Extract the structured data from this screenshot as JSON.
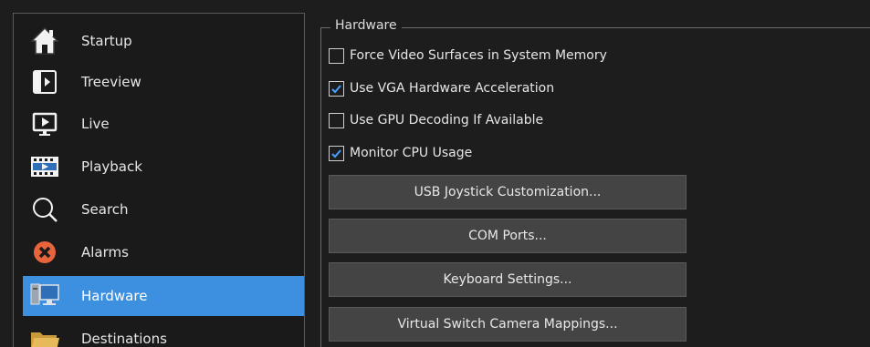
{
  "sidebar": {
    "items": [
      {
        "label": "Startup",
        "icon": "house-icon"
      },
      {
        "label": "Treeview",
        "icon": "treeview-icon"
      },
      {
        "label": "Live",
        "icon": "monitor-play-icon"
      },
      {
        "label": "Playback",
        "icon": "film-strip-icon"
      },
      {
        "label": "Search",
        "icon": "search-icon"
      },
      {
        "label": "Alarms",
        "icon": "alarm-x-icon"
      },
      {
        "label": "Hardware",
        "icon": "computer-icon",
        "selected": true
      },
      {
        "label": "Destinations",
        "icon": "folder-icon"
      }
    ]
  },
  "hardware": {
    "group_title": "Hardware",
    "checkboxes": [
      {
        "label": "Force Video Surfaces in System Memory",
        "checked": false
      },
      {
        "label": "Use VGA Hardware Acceleration",
        "checked": true
      },
      {
        "label": "Use GPU Decoding If Available",
        "checked": false
      },
      {
        "label": "Monitor CPU Usage",
        "checked": true
      }
    ],
    "buttons": [
      {
        "label": "USB Joystick Customization..."
      },
      {
        "label": "COM Ports..."
      },
      {
        "label": "Keyboard Settings..."
      },
      {
        "label": "Virtual Switch Camera Mappings..."
      }
    ]
  },
  "colors": {
    "background": "#1d1d1d",
    "selected": "#3d8fe0",
    "button": "#444444",
    "check_accent": "#4aa0ff"
  }
}
